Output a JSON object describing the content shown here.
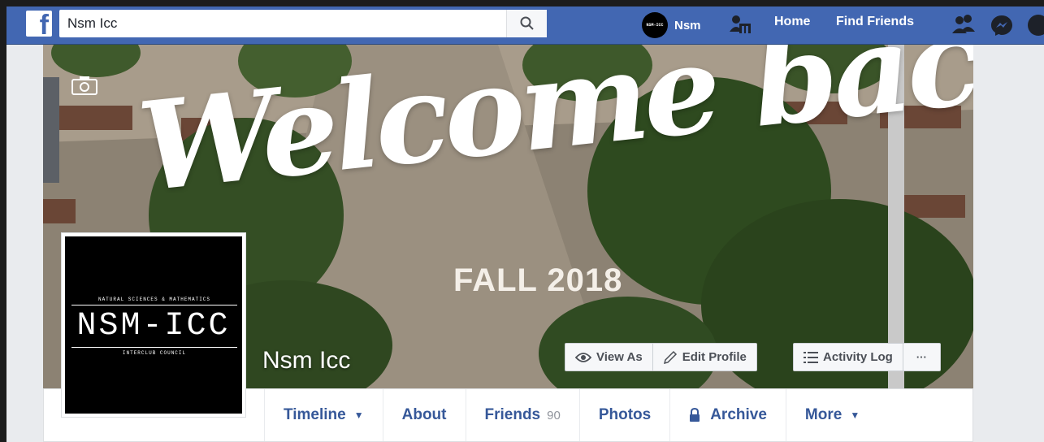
{
  "topbar": {
    "logo": "f",
    "search_value": "Nsm Icc",
    "user_avatar_text": "NSM-ICC",
    "user_name": "Nsm",
    "home_label": "Home",
    "find_friends_label": "Find Friends",
    "icons": [
      "facebook-logo",
      "search-icon",
      "find-friends-icon",
      "friend-requests-icon",
      "messenger-icon",
      "notifications-icon"
    ]
  },
  "cover": {
    "headline": "Welcome back!",
    "subline": "FALL 2018",
    "page_name": "Nsm Icc",
    "buttons": {
      "view_as": "View As",
      "edit_profile": "Edit Profile",
      "activity_log": "Activity Log",
      "more": "···"
    }
  },
  "profile_picture": {
    "top_text": "NATURAL SCIENCES & MATHEMATICS",
    "main_text": "NSM-ICC",
    "bottom_text": "INTERCLUB COUNCIL"
  },
  "tabs": {
    "timeline": "Timeline",
    "about": "About",
    "friends": "Friends",
    "friends_count": "90",
    "photos": "Photos",
    "archive": "Archive",
    "more": "More"
  },
  "colors": {
    "brand": "#4267b2",
    "link": "#365899",
    "page_bg": "#e9ebee"
  }
}
